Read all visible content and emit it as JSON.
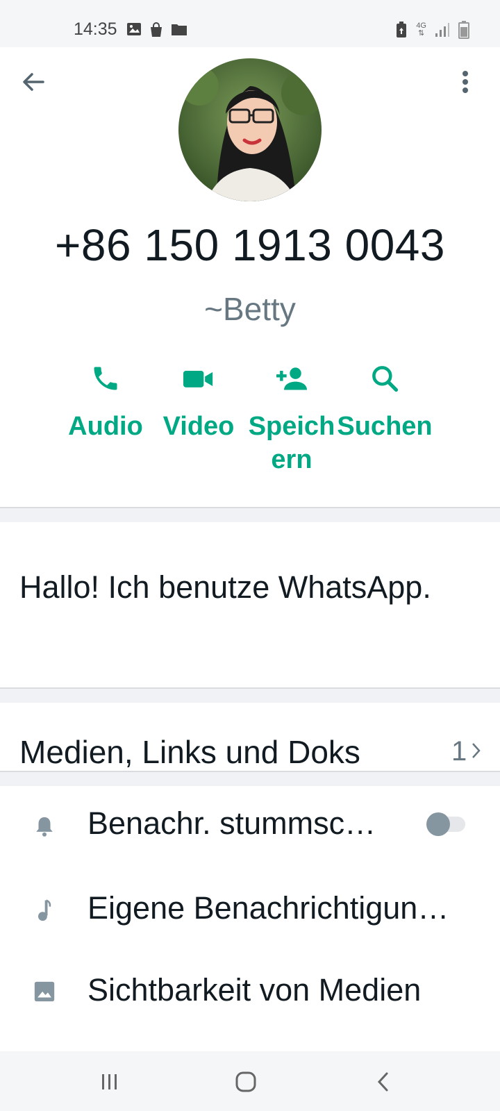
{
  "status_bar": {
    "time": "14:35",
    "network_label": "4G",
    "left_icons": [
      "image-icon",
      "shopping-bag-icon",
      "folder-icon"
    ],
    "right_icons": [
      "battery-saver-icon",
      "network-4g-icon",
      "signal-icon",
      "battery-icon"
    ]
  },
  "header": {
    "back_icon": "arrow-left-icon",
    "more_icon": "more-vertical-icon",
    "phone_number": "+86 150 1913 0043",
    "push_name": "~Betty"
  },
  "actions": [
    {
      "label": "Audio",
      "icon": "phone-icon"
    },
    {
      "label": "Video",
      "icon": "video-camera-icon"
    },
    {
      "label": "Speichern",
      "icon": "add-person-icon"
    },
    {
      "label": "Suchen",
      "icon": "search-icon"
    }
  ],
  "about": {
    "text": "Hallo! Ich benutze WhatsApp."
  },
  "media": {
    "label": "Medien, Links und Doks",
    "count": "1"
  },
  "settings": [
    {
      "label": "Benachr. stummsc…",
      "icon": "bell-icon",
      "toggle": false
    },
    {
      "label": "Eigene Benachrichtigun…",
      "icon": "music-note-icon"
    },
    {
      "label": "Sichtbarkeit von Medien",
      "icon": "image-icon"
    }
  ],
  "colors": {
    "accent": "#00a884",
    "secondary_text": "#667781",
    "primary_text": "#111b21"
  }
}
